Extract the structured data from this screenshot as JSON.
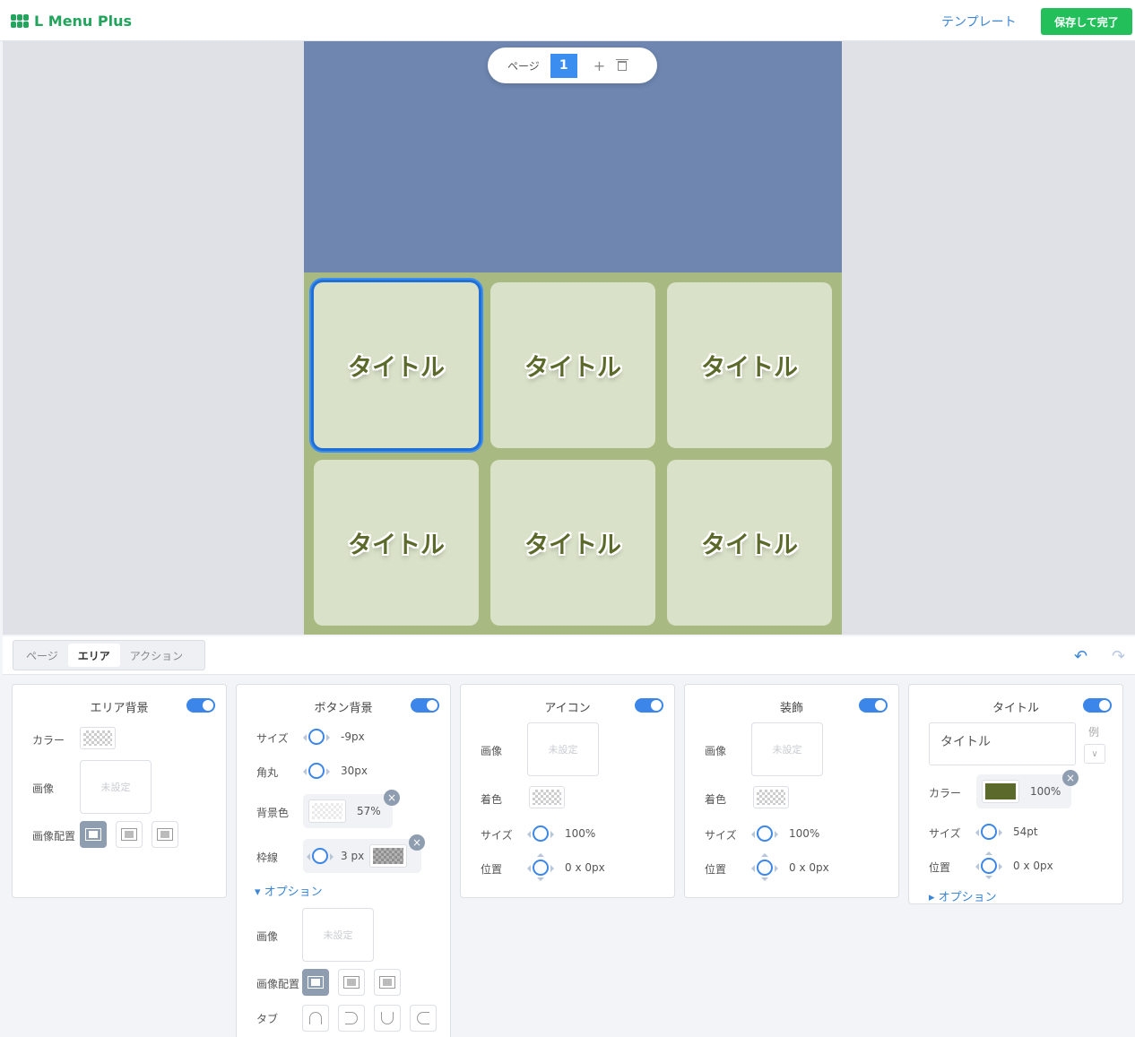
{
  "app": {
    "logo_text": "L Menu Plus"
  },
  "header": {
    "template_link": "テンプレート",
    "save_button": "保存して完了"
  },
  "page_pill": {
    "label": "ページ",
    "current_page": "1",
    "add_icon": "+"
  },
  "menu": {
    "colors": {
      "top": "#6e86b0",
      "bottom": "#a8b982",
      "tile": "#d9e1c8",
      "tile_text": "#5b6a2b"
    },
    "tiles": [
      "タイトル",
      "タイトル",
      "タイトル",
      "タイトル",
      "タイトル",
      "タイトル"
    ]
  },
  "tabs": [
    "ページ",
    "エリア",
    "アクション"
  ],
  "active_tab": "エリア",
  "cards": {
    "area_bg": {
      "title": "エリア背景",
      "color_label": "カラー",
      "image_label": "画像",
      "image_value": "未設定",
      "placement_label": "画像配置"
    },
    "button_bg": {
      "title": "ボタン背景",
      "size_label": "サイズ",
      "size_value": "-9px",
      "radius_label": "角丸",
      "radius_value": "30px",
      "bgcolor_label": "背景色",
      "bgcolor_value": "57%",
      "border_label": "枠線",
      "border_value": "3 px",
      "option_link": "▾ オプション",
      "image_label": "画像",
      "image_value": "未設定",
      "placement_label": "画像配置",
      "tab_label": "タブ"
    },
    "icon": {
      "title": "アイコン",
      "image_label": "画像",
      "image_value": "未設定",
      "tint_label": "着色",
      "size_label": "サイズ",
      "size_value": "100%",
      "pos_label": "位置",
      "pos_value": "0 x 0px"
    },
    "decoration": {
      "title": "装飾",
      "image_label": "画像",
      "image_value": "未設定",
      "tint_label": "着色",
      "size_label": "サイズ",
      "size_value": "100%",
      "pos_label": "位置",
      "pos_value": "0 x 0px"
    },
    "title": {
      "title": "タイトル",
      "input_value": "タイトル",
      "example_label": "例",
      "color_label": "カラー",
      "color_value": "100%",
      "color_swatch": "#5b6a2b",
      "size_label": "サイズ",
      "size_value": "54pt",
      "pos_label": "位置",
      "pos_value": "0 x 0px",
      "option_link": "▸ オプション"
    }
  }
}
